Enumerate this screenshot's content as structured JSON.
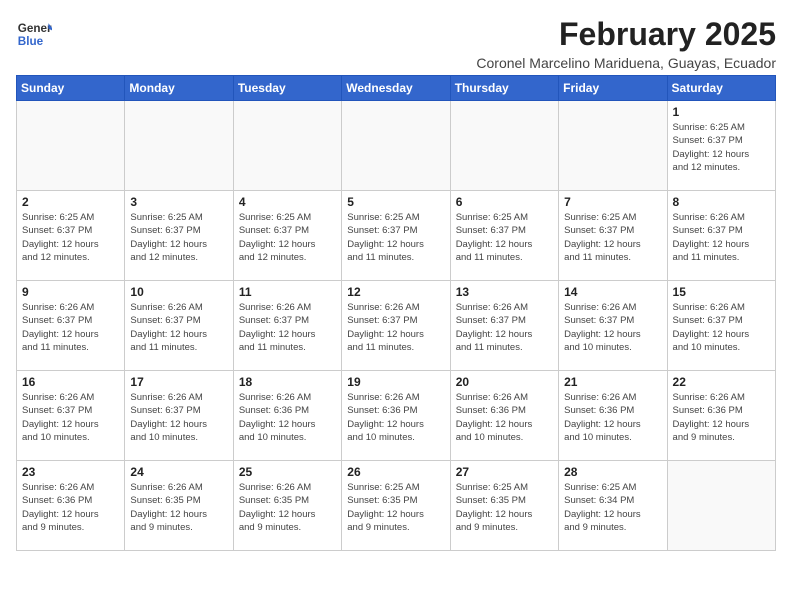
{
  "logo": {
    "line1": "General",
    "line2": "Blue"
  },
  "title": "February 2025",
  "subtitle": "Coronel Marcelino Mariduena, Guayas, Ecuador",
  "days_of_week": [
    "Sunday",
    "Monday",
    "Tuesday",
    "Wednesday",
    "Thursday",
    "Friday",
    "Saturday"
  ],
  "weeks": [
    [
      {
        "day": "",
        "info": ""
      },
      {
        "day": "",
        "info": ""
      },
      {
        "day": "",
        "info": ""
      },
      {
        "day": "",
        "info": ""
      },
      {
        "day": "",
        "info": ""
      },
      {
        "day": "",
        "info": ""
      },
      {
        "day": "1",
        "info": "Sunrise: 6:25 AM\nSunset: 6:37 PM\nDaylight: 12 hours\nand 12 minutes."
      }
    ],
    [
      {
        "day": "2",
        "info": "Sunrise: 6:25 AM\nSunset: 6:37 PM\nDaylight: 12 hours\nand 12 minutes."
      },
      {
        "day": "3",
        "info": "Sunrise: 6:25 AM\nSunset: 6:37 PM\nDaylight: 12 hours\nand 12 minutes."
      },
      {
        "day": "4",
        "info": "Sunrise: 6:25 AM\nSunset: 6:37 PM\nDaylight: 12 hours\nand 12 minutes."
      },
      {
        "day": "5",
        "info": "Sunrise: 6:25 AM\nSunset: 6:37 PM\nDaylight: 12 hours\nand 11 minutes."
      },
      {
        "day": "6",
        "info": "Sunrise: 6:25 AM\nSunset: 6:37 PM\nDaylight: 12 hours\nand 11 minutes."
      },
      {
        "day": "7",
        "info": "Sunrise: 6:25 AM\nSunset: 6:37 PM\nDaylight: 12 hours\nand 11 minutes."
      },
      {
        "day": "8",
        "info": "Sunrise: 6:26 AM\nSunset: 6:37 PM\nDaylight: 12 hours\nand 11 minutes."
      }
    ],
    [
      {
        "day": "9",
        "info": "Sunrise: 6:26 AM\nSunset: 6:37 PM\nDaylight: 12 hours\nand 11 minutes."
      },
      {
        "day": "10",
        "info": "Sunrise: 6:26 AM\nSunset: 6:37 PM\nDaylight: 12 hours\nand 11 minutes."
      },
      {
        "day": "11",
        "info": "Sunrise: 6:26 AM\nSunset: 6:37 PM\nDaylight: 12 hours\nand 11 minutes."
      },
      {
        "day": "12",
        "info": "Sunrise: 6:26 AM\nSunset: 6:37 PM\nDaylight: 12 hours\nand 11 minutes."
      },
      {
        "day": "13",
        "info": "Sunrise: 6:26 AM\nSunset: 6:37 PM\nDaylight: 12 hours\nand 11 minutes."
      },
      {
        "day": "14",
        "info": "Sunrise: 6:26 AM\nSunset: 6:37 PM\nDaylight: 12 hours\nand 10 minutes."
      },
      {
        "day": "15",
        "info": "Sunrise: 6:26 AM\nSunset: 6:37 PM\nDaylight: 12 hours\nand 10 minutes."
      }
    ],
    [
      {
        "day": "16",
        "info": "Sunrise: 6:26 AM\nSunset: 6:37 PM\nDaylight: 12 hours\nand 10 minutes."
      },
      {
        "day": "17",
        "info": "Sunrise: 6:26 AM\nSunset: 6:37 PM\nDaylight: 12 hours\nand 10 minutes."
      },
      {
        "day": "18",
        "info": "Sunrise: 6:26 AM\nSunset: 6:36 PM\nDaylight: 12 hours\nand 10 minutes."
      },
      {
        "day": "19",
        "info": "Sunrise: 6:26 AM\nSunset: 6:36 PM\nDaylight: 12 hours\nand 10 minutes."
      },
      {
        "day": "20",
        "info": "Sunrise: 6:26 AM\nSunset: 6:36 PM\nDaylight: 12 hours\nand 10 minutes."
      },
      {
        "day": "21",
        "info": "Sunrise: 6:26 AM\nSunset: 6:36 PM\nDaylight: 12 hours\nand 10 minutes."
      },
      {
        "day": "22",
        "info": "Sunrise: 6:26 AM\nSunset: 6:36 PM\nDaylight: 12 hours\nand 9 minutes."
      }
    ],
    [
      {
        "day": "23",
        "info": "Sunrise: 6:26 AM\nSunset: 6:36 PM\nDaylight: 12 hours\nand 9 minutes."
      },
      {
        "day": "24",
        "info": "Sunrise: 6:26 AM\nSunset: 6:35 PM\nDaylight: 12 hours\nand 9 minutes."
      },
      {
        "day": "25",
        "info": "Sunrise: 6:26 AM\nSunset: 6:35 PM\nDaylight: 12 hours\nand 9 minutes."
      },
      {
        "day": "26",
        "info": "Sunrise: 6:25 AM\nSunset: 6:35 PM\nDaylight: 12 hours\nand 9 minutes."
      },
      {
        "day": "27",
        "info": "Sunrise: 6:25 AM\nSunset: 6:35 PM\nDaylight: 12 hours\nand 9 minutes."
      },
      {
        "day": "28",
        "info": "Sunrise: 6:25 AM\nSunset: 6:34 PM\nDaylight: 12 hours\nand 9 minutes."
      },
      {
        "day": "",
        "info": ""
      }
    ]
  ]
}
